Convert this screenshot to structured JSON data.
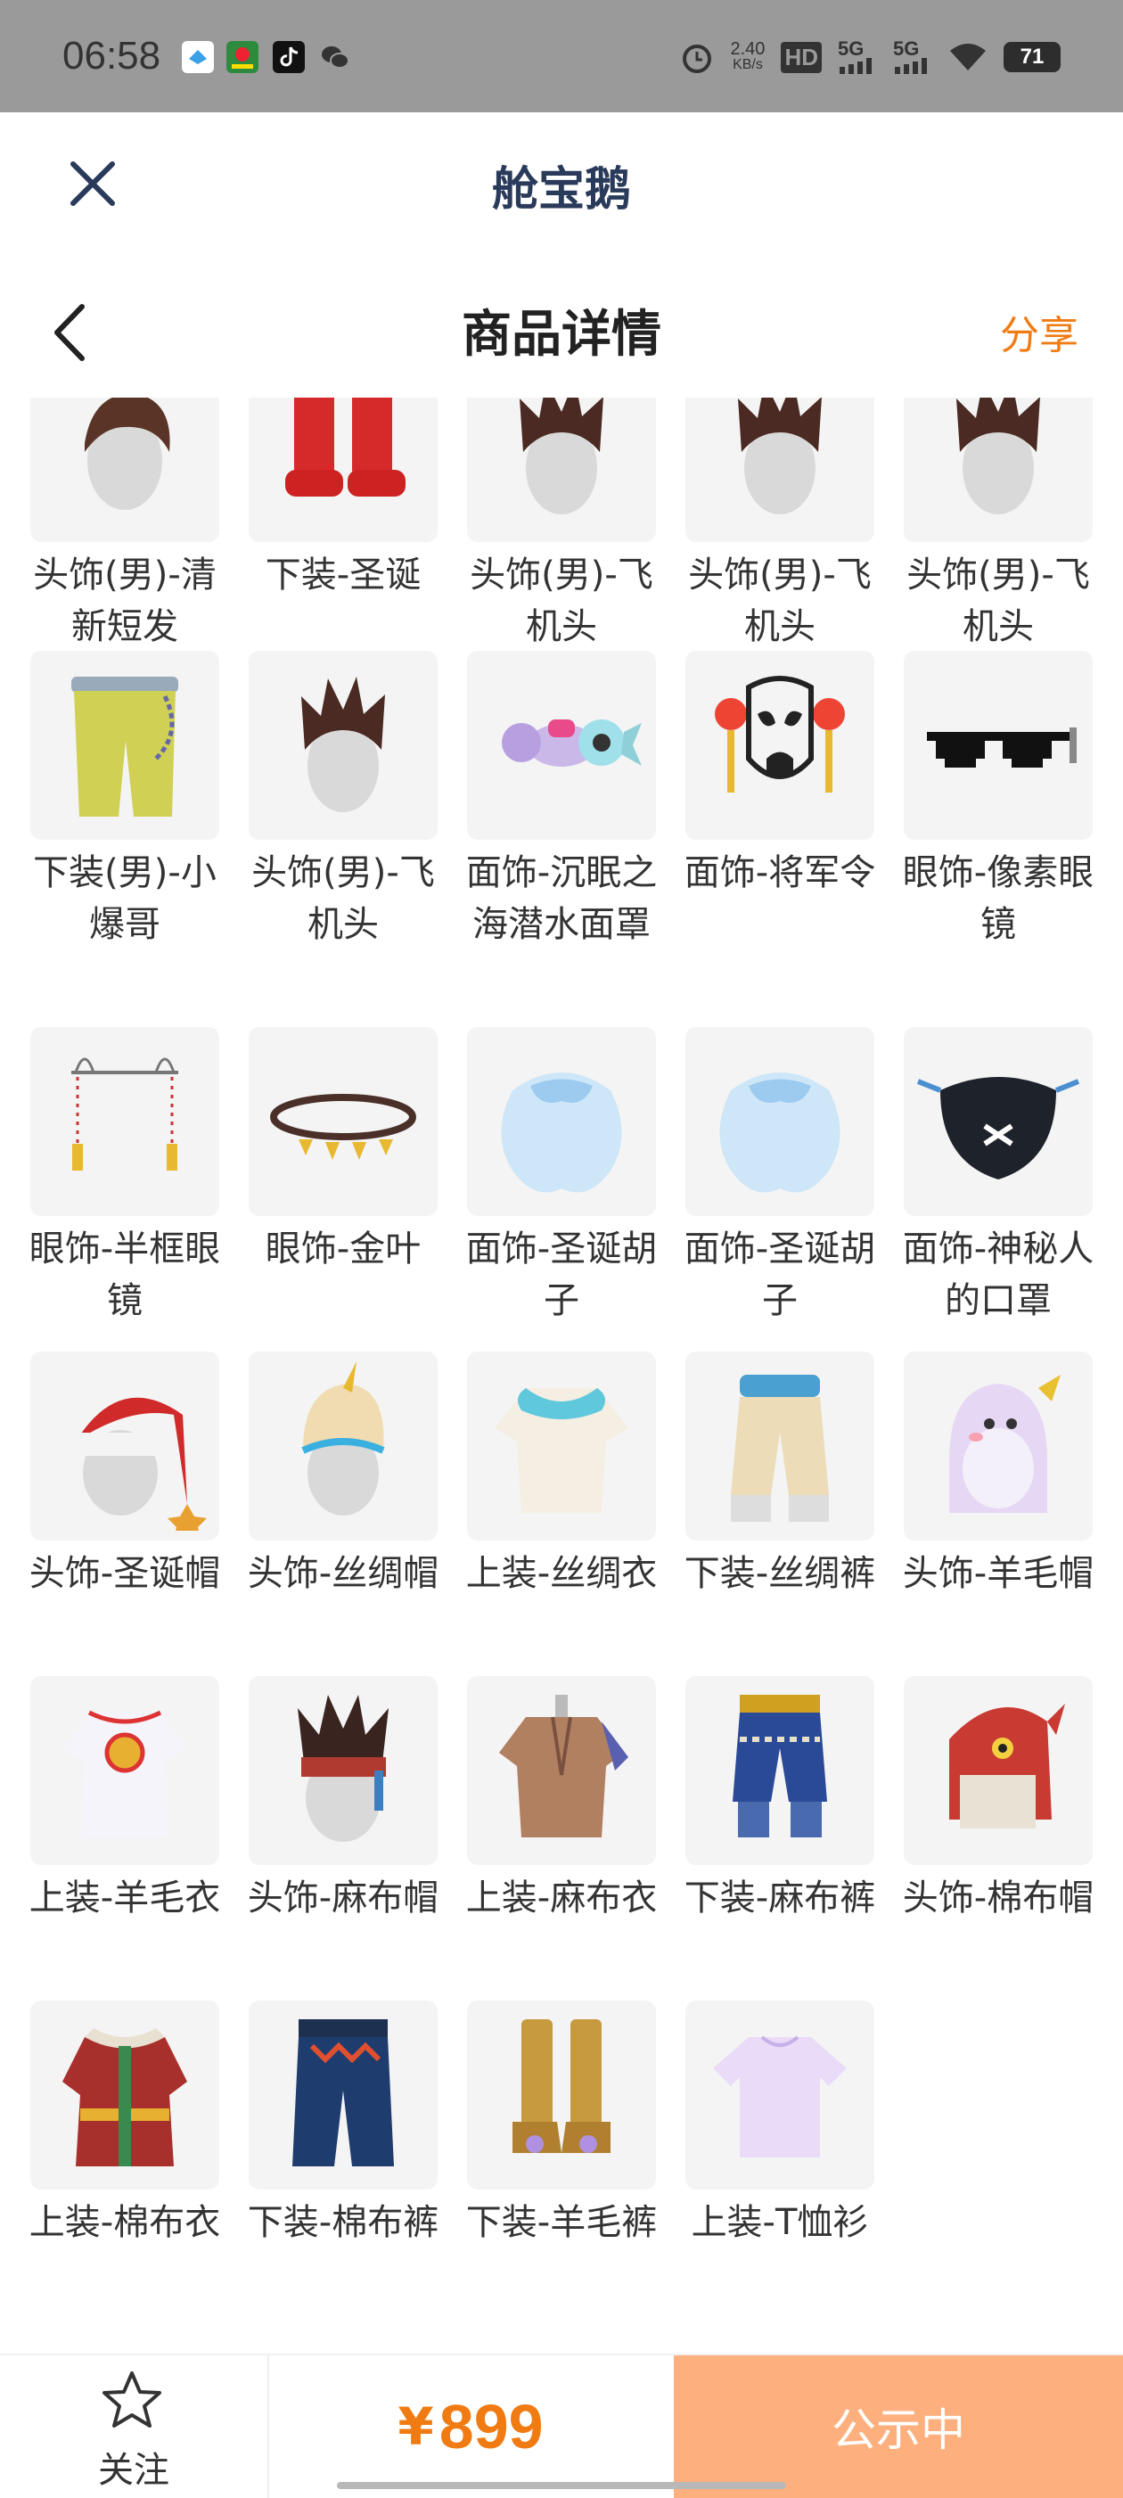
{
  "status_bar": {
    "time": "06:58",
    "net_speed_top": "2.40",
    "net_speed_bottom": "KB/s",
    "hd_label": "HD",
    "signal_1": "5G",
    "signal_2": "5G",
    "battery": "71",
    "icons": [
      "app-icon-1",
      "app-icon-2",
      "tiktok-icon",
      "wechat-icon",
      "alarm-icon",
      "wifi-icon"
    ]
  },
  "topbar": {
    "title": "舱宝鹅",
    "close_icon": "close-icon"
  },
  "header": {
    "title": "商品详情",
    "share": "分享",
    "back_icon": "back-chevron-icon"
  },
  "items": [
    {
      "label": "头饰(男)-清新短发",
      "icon": "hair-short"
    },
    {
      "label": "下装-圣诞",
      "icon": "red-boots"
    },
    {
      "label": "头饰(男)-飞机头",
      "icon": "hair-spiky"
    },
    {
      "label": "头饰(男)-飞机头",
      "icon": "hair-spiky"
    },
    {
      "label": "头饰(男)-飞机头",
      "icon": "hair-spiky"
    },
    {
      "label": "下装(男)-小爆哥",
      "icon": "yellow-pants"
    },
    {
      "label": "头饰(男)-飞机头",
      "icon": "hair-spiky"
    },
    {
      "label": "面饰-沉眠之海潜水面罩",
      "icon": "dive-mask"
    },
    {
      "label": "面饰-将军令",
      "icon": "opera-mask"
    },
    {
      "label": "眼饰-像素眼镜",
      "icon": "pixel-glasses"
    },
    {
      "label": "眼饰-半框眼镜",
      "icon": "half-frame-glasses"
    },
    {
      "label": "眼饰-金叶",
      "icon": "gold-leaf"
    },
    {
      "label": "面饰-圣诞胡子",
      "icon": "xmas-beard"
    },
    {
      "label": "面饰-圣诞胡子",
      "icon": "xmas-beard"
    },
    {
      "label": "面饰-神秘人的口罩",
      "icon": "black-mask"
    },
    {
      "label": "头饰-圣诞帽",
      "icon": "xmas-hat"
    },
    {
      "label": "头饰-丝绸帽",
      "icon": "silk-turban"
    },
    {
      "label": "上装-丝绸衣",
      "icon": "silk-shirt"
    },
    {
      "label": "下装-丝绸裤",
      "icon": "silk-pants"
    },
    {
      "label": "头饰-羊毛帽",
      "icon": "wool-hat"
    },
    {
      "label": "上装-羊毛衣",
      "icon": "wool-shirt"
    },
    {
      "label": "头饰-麻布帽",
      "icon": "linen-headband"
    },
    {
      "label": "上装-麻布衣",
      "icon": "linen-shirt"
    },
    {
      "label": "下装-麻布裤",
      "icon": "linen-pants"
    },
    {
      "label": "头饰-棉布帽",
      "icon": "cotton-hat"
    },
    {
      "label": "上装-棉布衣",
      "icon": "cotton-coat"
    },
    {
      "label": "下装-棉布裤",
      "icon": "cotton-pants"
    },
    {
      "label": "下装-羊毛裤",
      "icon": "wool-boots"
    },
    {
      "label": "上装-T恤衫",
      "icon": "tshirt"
    }
  ],
  "bottom_bar": {
    "follow_label": "关注",
    "currency": "¥",
    "price": "899",
    "status_button": "公示中",
    "accent": "#f07b12",
    "button_color": "#fdb07e"
  }
}
